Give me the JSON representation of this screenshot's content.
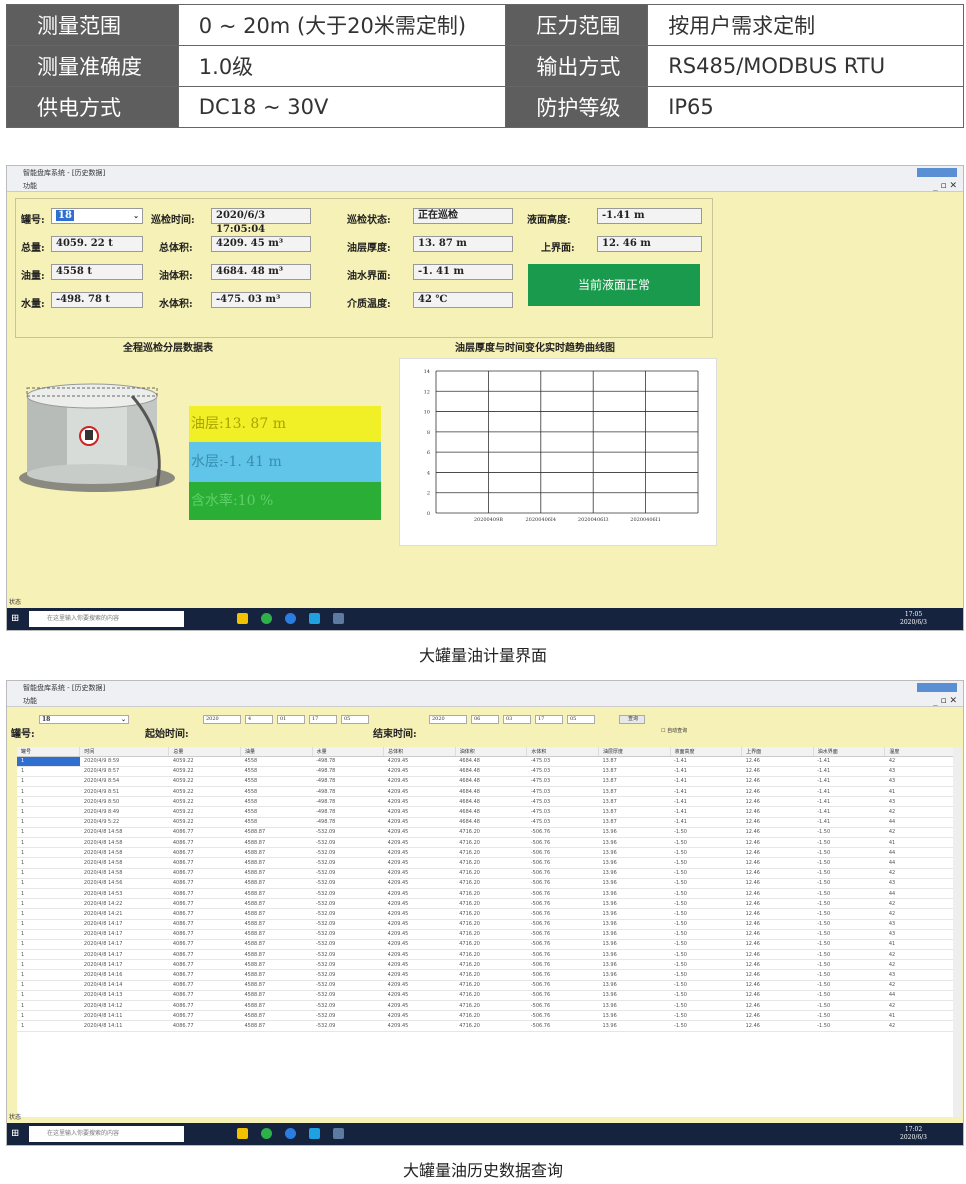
{
  "spec": [
    {
      "k1": "测量范围",
      "v1": "0 ~ 20m (大于20米需定制)",
      "k2": "压力范围",
      "v2": "按用户需求定制"
    },
    {
      "k1": "测量准确度",
      "v1": "1.0级",
      "k2": "输出方式",
      "v2": "RS485/MODBUS RTU"
    },
    {
      "k1": "供电方式",
      "v1": "DC18 ~ 30V",
      "k2": "防护等级",
      "v2": "IP65"
    }
  ],
  "screen1": {
    "window_title": "智能盘库系统 - [历史数据]",
    "menu": "功能",
    "labels": {
      "tank_no": "罐号:",
      "patrol_time": "巡检时间:",
      "patrol_status": "巡检状态:",
      "level": "液面高度:",
      "total_mass": "总量:",
      "total_vol": "总体积:",
      "oil_thick": "油层厚度:",
      "upper": "上界面:",
      "oil_mass": "油量:",
      "oil_vol": "油体积:",
      "oil_water": "油水界面:",
      "water_mass": "水量:",
      "water_vol": "水体积:",
      "temp": "介质温度:"
    },
    "values": {
      "tank_no": "18",
      "patrol_time": "2020/6/3 17:05:04",
      "patrol_status": "正在巡检",
      "level": "-1.41  m",
      "total_mass": "4059. 22  t",
      "total_vol": "4209. 45  m³",
      "oil_thick": "13. 87  m",
      "upper": "12. 46  m",
      "oil_mass": "4558  t",
      "oil_vol": "4684. 48  m³",
      "oil_water": "-1. 41  m",
      "water_mass": "-498. 78  t",
      "water_vol": "-475. 03  m³",
      "temp": "42  ℃"
    },
    "status_text": "当前液面正常",
    "layer_title": "全程巡检分层数据表",
    "oil_layer": "油层:13. 87  m",
    "water_layer": "水层:-1. 41  m",
    "water_ratio": "含水率:10  %",
    "chart_title": "油层厚度与时间变化实时趋势曲线图",
    "status_bar": "状态",
    "taskbar_search": "在这里输入你要搜索的内容",
    "clock_time": "17:05",
    "clock_date": "2020/6/3"
  },
  "chart_data": {
    "type": "line",
    "title": "油层厚度与时间变化实时趋势曲线图",
    "categories": [
      "20200409B",
      "20200406I4",
      "20200406I3",
      "20200406I1"
    ],
    "series": [],
    "ylim": [
      0,
      14
    ],
    "yticks": [
      "0",
      "2",
      "4",
      "6",
      "8",
      "10",
      "12",
      "14"
    ],
    "grid": true
  },
  "caption1": "大罐量油计量界面",
  "screen2": {
    "window_title": "智能盘库系统 - [历史数据]",
    "menu": "功能",
    "tank_label": "罐号:",
    "tank_value": "18",
    "start_label": "起始时间:",
    "end_label": "结束时间:",
    "start_sel": [
      "2020",
      "4",
      "01",
      "17",
      "05"
    ],
    "end_sel": [
      "2020",
      "06",
      "03",
      "17",
      "05"
    ],
    "query_btn": "查询",
    "auto_query": "自动查询",
    "status_bar": "状态",
    "headers": [
      "罐号",
      "时间",
      "总量",
      "油量",
      "水量",
      "总体积",
      "油体积",
      "水体积",
      "油层厚度",
      "液面高度",
      "上界面",
      "油水界面",
      "温度"
    ],
    "rows": [
      [
        "1",
        "2020/4/9 8:59",
        "4059.22",
        "4558",
        "-498.78",
        "4209.45",
        "4684.48",
        "-475.03",
        "13.87",
        "-1.41",
        "12.46",
        "-1.41",
        "42"
      ],
      [
        "1",
        "2020/4/9 8:57",
        "4059.22",
        "4558",
        "-498.78",
        "4209.45",
        "4684.48",
        "-475.03",
        "13.87",
        "-1.41",
        "12.46",
        "-1.41",
        "43"
      ],
      [
        "1",
        "2020/4/9 8:54",
        "4059.22",
        "4558",
        "-498.78",
        "4209.45",
        "4684.48",
        "-475.03",
        "13.87",
        "-1.41",
        "12.46",
        "-1.41",
        "43"
      ],
      [
        "1",
        "2020/4/9 8:51",
        "4059.22",
        "4558",
        "-498.78",
        "4209.45",
        "4684.48",
        "-475.03",
        "13.87",
        "-1.41",
        "12.46",
        "-1.41",
        "41"
      ],
      [
        "1",
        "2020/4/9 8:50",
        "4059.22",
        "4558",
        "-498.78",
        "4209.45",
        "4684.48",
        "-475.03",
        "13.87",
        "-1.41",
        "12.46",
        "-1.41",
        "43"
      ],
      [
        "1",
        "2020/4/9 8:49",
        "4059.22",
        "4558",
        "-498.78",
        "4209.45",
        "4684.48",
        "-475.03",
        "13.87",
        "-1.41",
        "12.46",
        "-1.41",
        "42"
      ],
      [
        "1",
        "2020/4/9 5:22",
        "4059.22",
        "4558",
        "-498.78",
        "4209.45",
        "4684.48",
        "-475.03",
        "13.87",
        "-1.41",
        "12.46",
        "-1.41",
        "44"
      ],
      [
        "1",
        "2020/4/8 14:58",
        "4086.77",
        "4588.87",
        "-532.09",
        "4209.45",
        "4716.20",
        "-506.76",
        "13.96",
        "-1.50",
        "12.46",
        "-1.50",
        "42"
      ],
      [
        "1",
        "2020/4/8 14:58",
        "4086.77",
        "4588.87",
        "-532.09",
        "4209.45",
        "4716.20",
        "-506.76",
        "13.96",
        "-1.50",
        "12.46",
        "-1.50",
        "41"
      ],
      [
        "1",
        "2020/4/8 14:58",
        "4086.77",
        "4588.87",
        "-532.09",
        "4209.45",
        "4716.20",
        "-506.76",
        "13.96",
        "-1.50",
        "12.46",
        "-1.50",
        "44"
      ],
      [
        "1",
        "2020/4/8 14:58",
        "4086.77",
        "4588.87",
        "-532.09",
        "4209.45",
        "4716.20",
        "-506.76",
        "13.96",
        "-1.50",
        "12.46",
        "-1.50",
        "44"
      ],
      [
        "1",
        "2020/4/8 14:58",
        "4086.77",
        "4588.87",
        "-532.09",
        "4209.45",
        "4716.20",
        "-506.76",
        "13.96",
        "-1.50",
        "12.46",
        "-1.50",
        "42"
      ],
      [
        "1",
        "2020/4/8 14:56",
        "4086.77",
        "4588.87",
        "-532.09",
        "4209.45",
        "4716.20",
        "-506.76",
        "13.96",
        "-1.50",
        "12.46",
        "-1.50",
        "43"
      ],
      [
        "1",
        "2020/4/8 14:53",
        "4086.77",
        "4588.87",
        "-532.09",
        "4209.45",
        "4716.20",
        "-506.76",
        "13.96",
        "-1.50",
        "12.46",
        "-1.50",
        "44"
      ],
      [
        "1",
        "2020/4/8 14:22",
        "4086.77",
        "4588.87",
        "-532.09",
        "4209.45",
        "4716.20",
        "-506.76",
        "13.96",
        "-1.50",
        "12.46",
        "-1.50",
        "42"
      ],
      [
        "1",
        "2020/4/8 14:21",
        "4086.77",
        "4588.87",
        "-532.09",
        "4209.45",
        "4716.20",
        "-506.76",
        "13.96",
        "-1.50",
        "12.46",
        "-1.50",
        "42"
      ],
      [
        "1",
        "2020/4/8 14:17",
        "4086.77",
        "4588.87",
        "-532.09",
        "4209.45",
        "4716.20",
        "-506.76",
        "13.96",
        "-1.50",
        "12.46",
        "-1.50",
        "43"
      ],
      [
        "1",
        "2020/4/8 14:17",
        "4086.77",
        "4588.87",
        "-532.09",
        "4209.45",
        "4716.20",
        "-506.76",
        "13.96",
        "-1.50",
        "12.46",
        "-1.50",
        "43"
      ],
      [
        "1",
        "2020/4/8 14:17",
        "4086.77",
        "4588.87",
        "-532.09",
        "4209.45",
        "4716.20",
        "-506.76",
        "13.96",
        "-1.50",
        "12.46",
        "-1.50",
        "41"
      ],
      [
        "1",
        "2020/4/8 14:17",
        "4086.77",
        "4588.87",
        "-532.09",
        "4209.45",
        "4716.20",
        "-506.76",
        "13.96",
        "-1.50",
        "12.46",
        "-1.50",
        "42"
      ],
      [
        "1",
        "2020/4/8 14:17",
        "4086.77",
        "4588.87",
        "-532.09",
        "4209.45",
        "4716.20",
        "-506.76",
        "13.96",
        "-1.50",
        "12.46",
        "-1.50",
        "42"
      ],
      [
        "1",
        "2020/4/8 14:16",
        "4086.77",
        "4588.87",
        "-532.09",
        "4209.45",
        "4716.20",
        "-506.76",
        "13.96",
        "-1.50",
        "12.46",
        "-1.50",
        "43"
      ],
      [
        "1",
        "2020/4/8 14:14",
        "4086.77",
        "4588.87",
        "-532.09",
        "4209.45",
        "4716.20",
        "-506.76",
        "13.96",
        "-1.50",
        "12.46",
        "-1.50",
        "42"
      ],
      [
        "1",
        "2020/4/8 14:13",
        "4086.77",
        "4588.87",
        "-532.09",
        "4209.45",
        "4716.20",
        "-506.76",
        "13.96",
        "-1.50",
        "12.46",
        "-1.50",
        "44"
      ],
      [
        "1",
        "2020/4/8 14:12",
        "4086.77",
        "4588.87",
        "-532.09",
        "4209.45",
        "4716.20",
        "-506.76",
        "13.96",
        "-1.50",
        "12.46",
        "-1.50",
        "42"
      ],
      [
        "1",
        "2020/4/8 14:11",
        "4086.77",
        "4588.87",
        "-532.09",
        "4209.45",
        "4716.20",
        "-506.76",
        "13.96",
        "-1.50",
        "12.46",
        "-1.50",
        "41"
      ],
      [
        "1",
        "2020/4/8 14:11",
        "4086.77",
        "4588.87",
        "-532.09",
        "4209.45",
        "4716.20",
        "-506.76",
        "13.96",
        "-1.50",
        "12.46",
        "-1.50",
        "42"
      ]
    ],
    "taskbar_search": "在这里输入你要搜索的内容",
    "clock_time": "17:02",
    "clock_date": "2020/6/3"
  },
  "caption2": "大罐量油历史数据查询"
}
